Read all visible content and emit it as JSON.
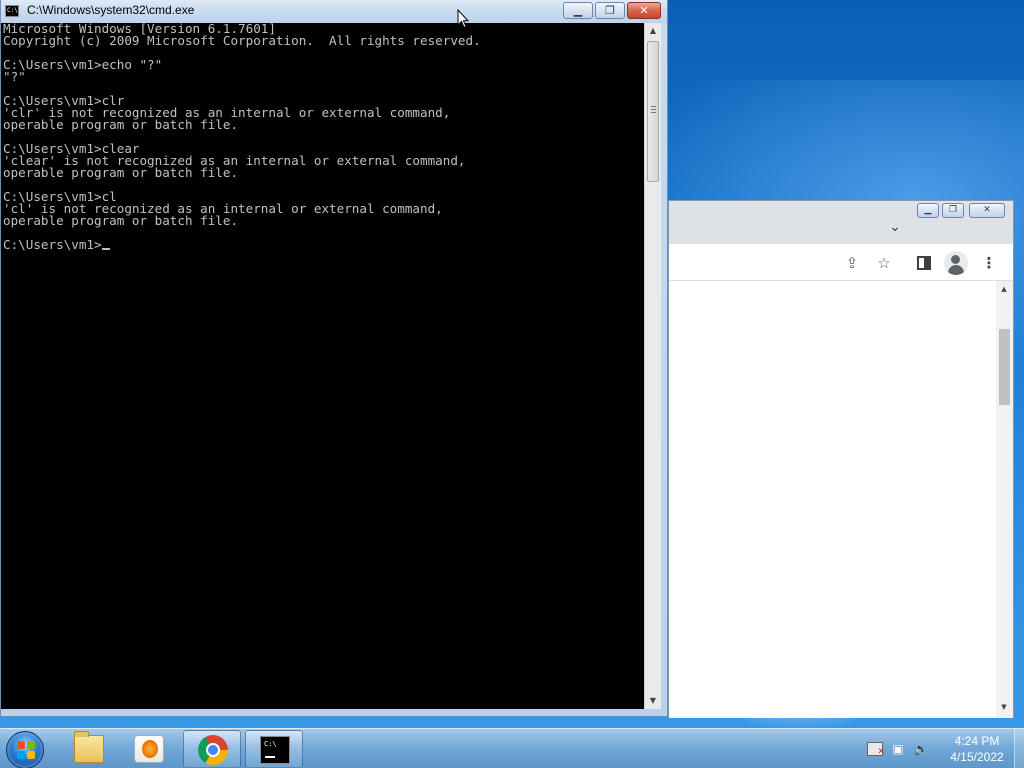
{
  "cmd_window": {
    "title": "C:\\Windows\\system32\\cmd.exe",
    "buttons": {
      "minimize": "▁",
      "maximize": "❐",
      "close": "✕"
    },
    "console_lines": [
      "Microsoft Windows [Version 6.1.7601]",
      "Copyright (c) 2009 Microsoft Corporation.  All rights reserved.",
      "",
      "C:\\Users\\vm1>echo \"?\"",
      "\"?\"",
      "",
      "C:\\Users\\vm1>clr",
      "'clr' is not recognized as an internal or external command,",
      "operable program or batch file.",
      "",
      "C:\\Users\\vm1>clear",
      "'clear' is not recognized as an internal or external command,",
      "operable program or batch file.",
      "",
      "C:\\Users\\vm1>cl",
      "'cl' is not recognized as an internal or external command,",
      "operable program or batch file.",
      ""
    ],
    "prompt": "C:\\Users\\vm1>",
    "colors": {
      "background": "#000000",
      "text": "#c0c0c0"
    }
  },
  "chrome_window": {
    "buttons": {
      "minimize": "▁",
      "maximize": "❐",
      "close": "✕"
    },
    "tab_search_icon": "⌄",
    "toolbar_icons": [
      "share-icon",
      "bookmark-star-icon",
      "side-panel-icon",
      "profile-avatar-icon",
      "menu-kebab-icon"
    ],
    "glyphs": {
      "share": "⇪",
      "star": "☆",
      "menu": "⋮",
      "scroll_up": "▲",
      "scroll_down": "▼"
    }
  },
  "taskbar": {
    "pinned": [
      "windows-explorer",
      "windows-media-player",
      "google-chrome",
      "command-prompt"
    ],
    "cmd_icon_text": "C:\\",
    "clock_time": "4:24 PM",
    "clock_date": "4/15/2022",
    "tray_glyphs": {
      "network": "▣",
      "volume": "🔈"
    }
  }
}
